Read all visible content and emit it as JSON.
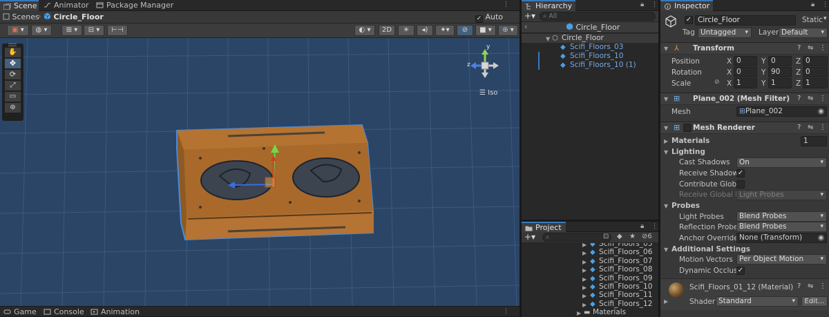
{
  "scene_panel": {
    "tabs": [
      {
        "label": "Scene",
        "active": true
      },
      {
        "label": "Animator",
        "active": false
      },
      {
        "label": "Package Manager",
        "active": false
      }
    ],
    "breadcrumb": {
      "root": "Scenes",
      "object": "Circle_Floor"
    },
    "auto_save_label": "Auto Save",
    "auto_save_checked": true,
    "toolbar_2d_label": "2D",
    "gizmo": {
      "y": "y",
      "z": "z",
      "view_mode": "Iso"
    }
  },
  "bottom_tabs": [
    {
      "label": "Game"
    },
    {
      "label": "Console"
    },
    {
      "label": "Animation"
    }
  ],
  "hierarchy": {
    "title": "Hierarchy",
    "search_placeholder": "All",
    "prefab_title": "Circle_Floor",
    "root": "Circle_Floor",
    "children": [
      "Scifi_Floors_03",
      "Scifi_Floors_10",
      "Scifi_Floors_10 (1)"
    ]
  },
  "project": {
    "title": "Project",
    "hidden_count": "6",
    "items": [
      "Scifi_Floors_05",
      "Scifi_Floors_06",
      "Scifi_Floors_07",
      "Scifi_Floors_08",
      "Scifi_Floors_09",
      "Scifi_Floors_10",
      "Scifi_Floors_11",
      "Scifi_Floors_12"
    ],
    "folder": "Materials"
  },
  "inspector": {
    "title": "Inspector",
    "object_name": "Circle_Floor",
    "active_checked": true,
    "static_label": "Static",
    "tag_label": "Tag",
    "tag_value": "Untagged",
    "layer_label": "Layer",
    "layer_value": "Default",
    "transform": {
      "title": "Transform",
      "rows": [
        {
          "label": "Position",
          "x": "0",
          "y": "0",
          "z": "0"
        },
        {
          "label": "Rotation",
          "x": "0",
          "y": "90",
          "z": "0"
        },
        {
          "label": "Scale",
          "x": "1",
          "y": "1",
          "z": "1"
        }
      ],
      "axis_labels": [
        "X",
        "Y",
        "Z"
      ]
    },
    "mesh_filter": {
      "title": "Plane_002 (Mesh Filter)",
      "mesh_label": "Mesh",
      "mesh_value": "Plane_002"
    },
    "mesh_renderer": {
      "title": "Mesh Renderer",
      "materials_label": "Materials",
      "materials_count": "1",
      "lighting_label": "Lighting",
      "cast_shadows_label": "Cast Shadows",
      "cast_shadows_value": "On",
      "receive_shadows_label": "Receive Shadows",
      "receive_shadows_checked": true,
      "contribute_gi_label": "Contribute Global",
      "receive_gi_label": "Receive Global Illu",
      "receive_gi_value": "Light Probes",
      "probes_label": "Probes",
      "light_probes_label": "Light Probes",
      "light_probes_value": "Blend Probes",
      "reflection_probes_label": "Reflection Probes",
      "reflection_probes_value": "Blend Probes",
      "anchor_override_label": "Anchor Override",
      "anchor_override_value": "None (Transform)",
      "additional_label": "Additional Settings",
      "motion_vectors_label": "Motion Vectors",
      "motion_vectors_value": "Per Object Motion",
      "dynamic_occlusion_label": "Dynamic Occlusio",
      "dynamic_occlusion_checked": true
    },
    "material": {
      "name": "Scifi_Floors_01_12 (Material)",
      "shader_label": "Shader",
      "shader_value": "Standard",
      "edit_label": "Edit..."
    }
  },
  "colors": {
    "scene_bg": "#2a4566",
    "selection_blue": "#4d8ad6",
    "floor_orange": "#a8692a",
    "accent": "#3a79bb"
  }
}
